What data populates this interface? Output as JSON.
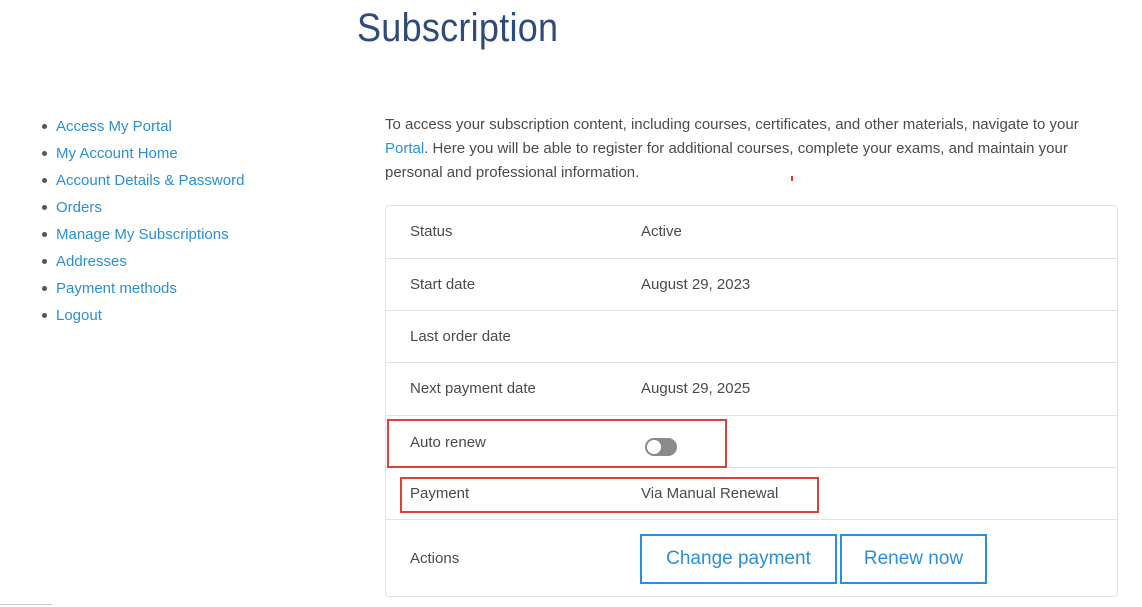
{
  "page": {
    "title": "Subscription"
  },
  "nav": {
    "items": [
      {
        "label": "Access My Portal"
      },
      {
        "label": "My Account Home"
      },
      {
        "label": "Account Details & Password"
      },
      {
        "label": "Orders"
      },
      {
        "label": "Manage My Subscriptions"
      },
      {
        "label": "Addresses"
      },
      {
        "label": "Payment methods"
      },
      {
        "label": "Logout"
      }
    ]
  },
  "intro": {
    "text_before_link": "To access your subscription content, including courses, certificates, and other materials, navigate to your ",
    "link_label": "Portal",
    "text_after_link": ". Here you will be able to register for additional courses, complete your exams, and maintain your personal and professional information."
  },
  "subscription": {
    "status_label": "Status",
    "status_value": "Active",
    "start_date_label": "Start date",
    "start_date_value": "August 29, 2023",
    "last_order_date_label": "Last order date",
    "last_order_date_value": "",
    "next_payment_date_label": "Next payment date",
    "next_payment_date_value": "August 29, 2025",
    "auto_renew_label": "Auto renew",
    "auto_renew_enabled": false,
    "payment_label": "Payment",
    "payment_value": "Via Manual Renewal",
    "actions_label": "Actions",
    "change_payment_button": "Change payment",
    "renew_now_button": "Renew now"
  },
  "colors": {
    "title": "#2f4b7c",
    "link": "#2a8fd8",
    "highlight": "#d9443a",
    "toggle_off": "#8a8a8a"
  }
}
